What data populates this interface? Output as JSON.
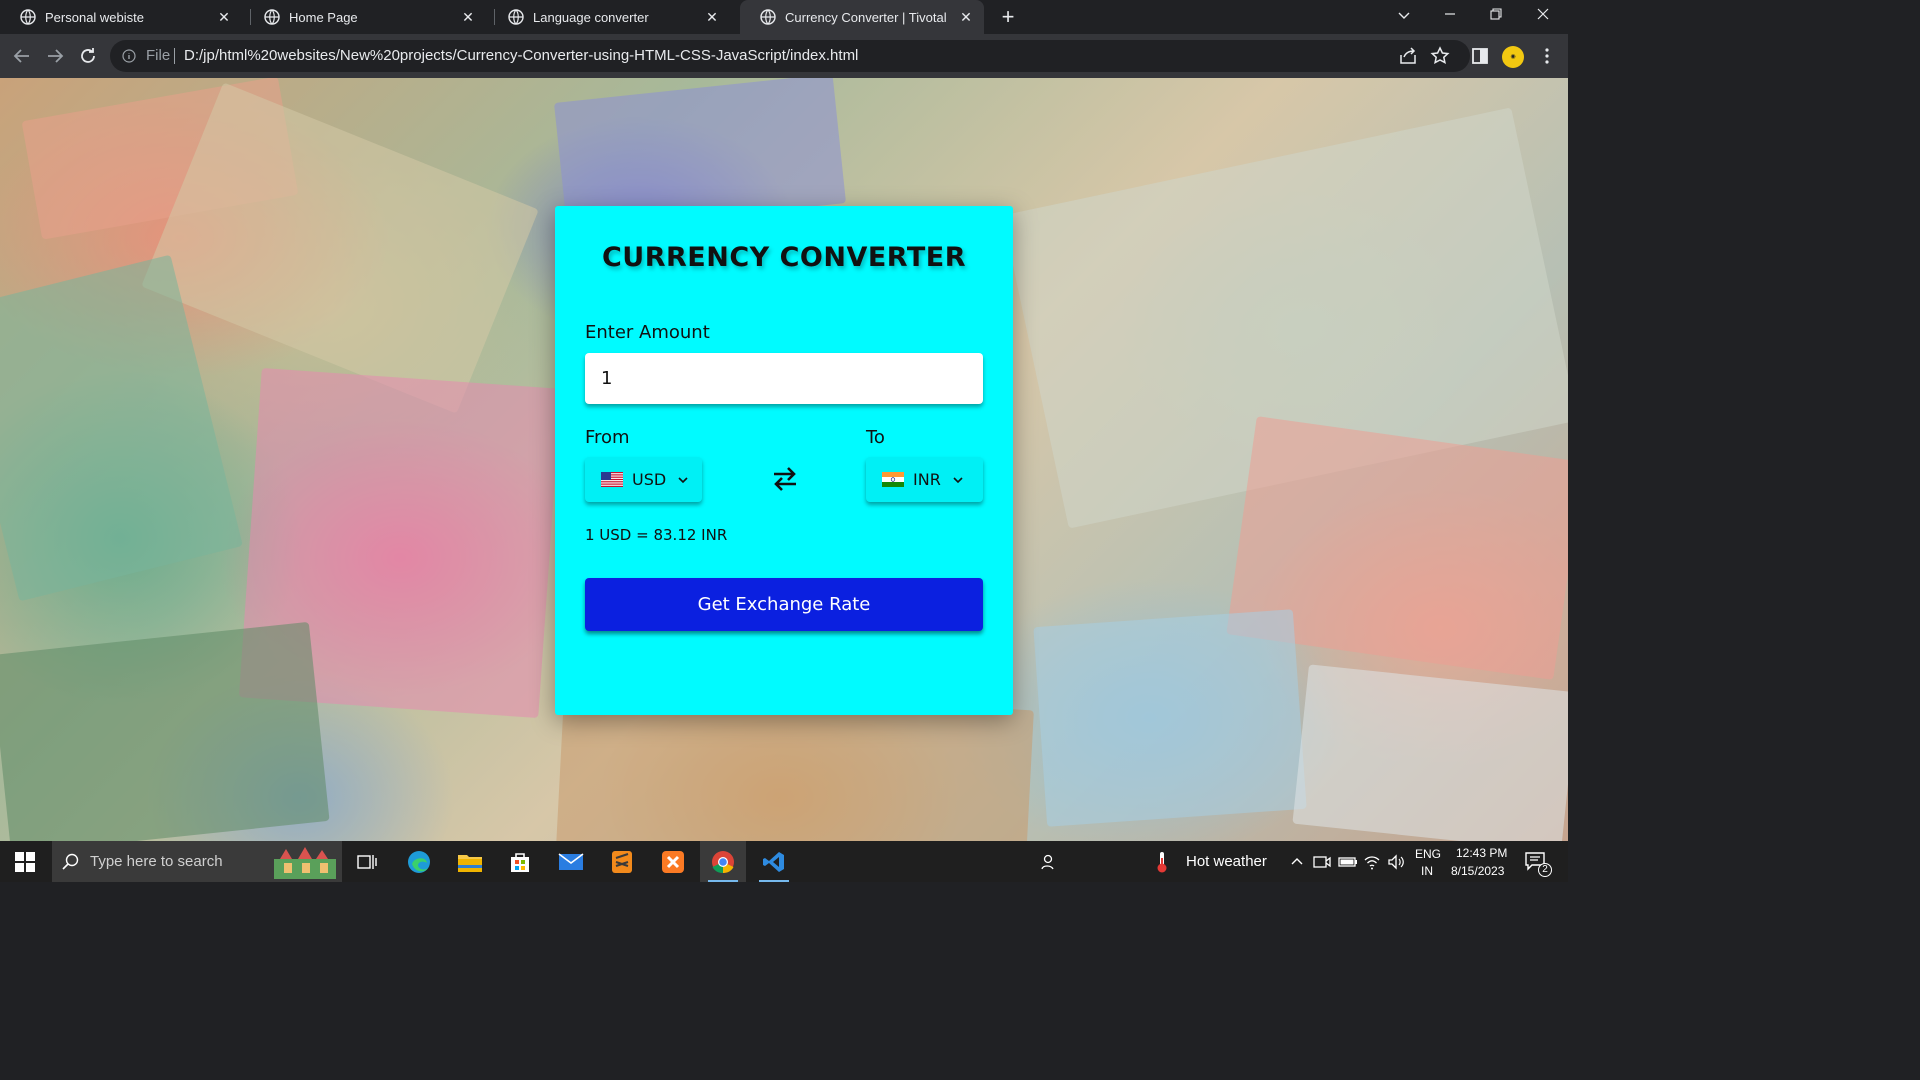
{
  "browser": {
    "tabs": [
      {
        "title": "Personal webiste",
        "active": false
      },
      {
        "title": "Home Page",
        "active": false
      },
      {
        "title": "Language converter",
        "active": false
      },
      {
        "title": "Currency Converter | Tivotal",
        "active": true
      }
    ],
    "omnibox": {
      "scheme_label": "File",
      "url": "D:/jp/html%20websites/New%20projects/Currency-Converter-using-HTML-CSS-JavaScript/index.html"
    }
  },
  "page": {
    "title": "CURRENCY CONVERTER",
    "amount_label": "Enter Amount",
    "amount_value": "1",
    "from_label": "From",
    "to_label": "To",
    "from_currency": "USD",
    "to_currency": "INR",
    "rate_text": "1 USD = 83.12 INR",
    "button_label": "Get Exchange Rate",
    "colors": {
      "card": "#00fbff",
      "button": "#0b20e0"
    }
  },
  "taskbar": {
    "search_placeholder": "Type here to search",
    "weather": "Hot weather",
    "lang_top": "ENG",
    "lang_bottom": "IN",
    "time": "12:43 PM",
    "date": "8/15/2023",
    "notification_count": "2"
  }
}
